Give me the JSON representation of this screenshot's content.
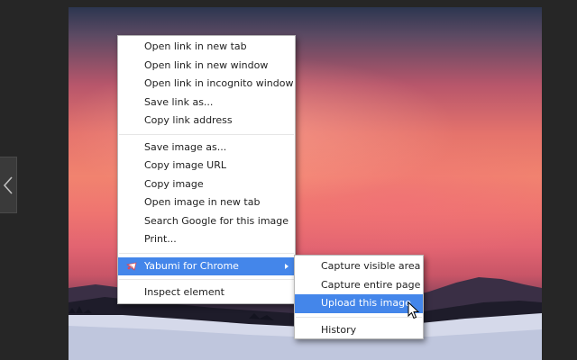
{
  "context_menu": {
    "groups": [
      {
        "items": [
          {
            "label": "Open link in new tab"
          },
          {
            "label": "Open link in new window"
          },
          {
            "label": "Open link in incognito window"
          },
          {
            "label": "Save link as..."
          },
          {
            "label": "Copy link address"
          }
        ]
      },
      {
        "items": [
          {
            "label": "Save image as..."
          },
          {
            "label": "Copy image URL"
          },
          {
            "label": "Copy image"
          },
          {
            "label": "Open image in new tab"
          },
          {
            "label": "Search Google for this image"
          },
          {
            "label": "Print..."
          }
        ]
      }
    ],
    "extension_item": {
      "label": "Yabumi for Chrome",
      "icon": "yabumi-icon",
      "highlighted": true
    },
    "inspect_item": {
      "label": "Inspect element"
    }
  },
  "submenu": {
    "items": [
      {
        "label": "Capture visible area"
      },
      {
        "label": "Capture entire page"
      },
      {
        "label": "Upload this image",
        "highlighted": true
      }
    ],
    "history_item": {
      "label": "History"
    }
  },
  "colors": {
    "highlight": "#4486ea",
    "page_background": "#262626"
  },
  "icons": {
    "nav": "chevron-left-icon",
    "cursor": "mouse-pointer-icon"
  }
}
